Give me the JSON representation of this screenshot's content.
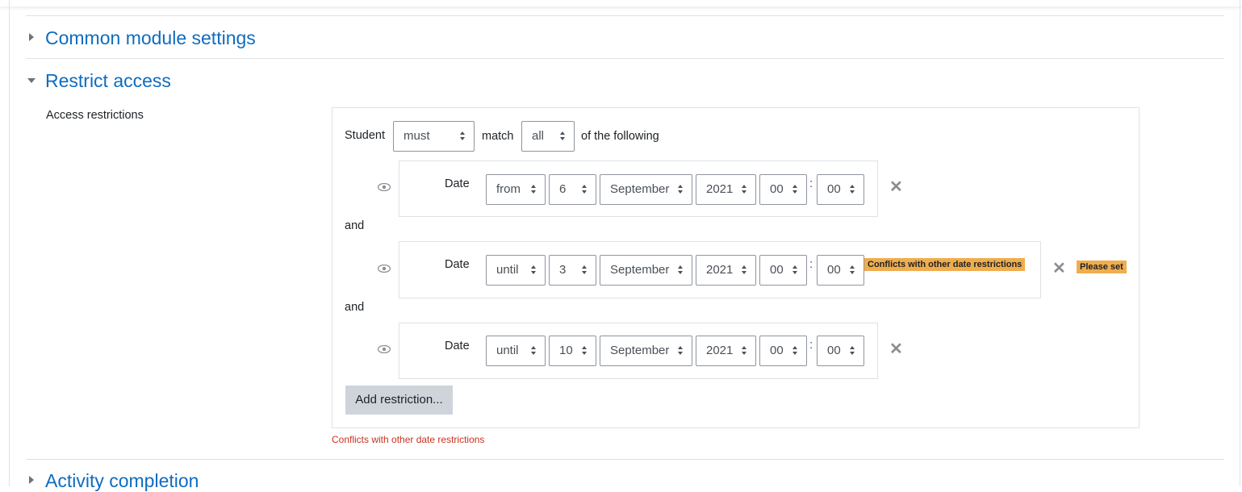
{
  "sections": {
    "common": {
      "title": "Common module settings"
    },
    "restrict": {
      "title": "Restrict access",
      "field_label": "Access restrictions"
    },
    "completion": {
      "title": "Activity completion"
    }
  },
  "header_row": {
    "student_label": "Student",
    "must_value": "must",
    "match_label": "match",
    "all_value": "all",
    "following_label": "of the following"
  },
  "conditions": [
    {
      "date_label": "Date",
      "direction": "from",
      "day": "6",
      "month": "September",
      "year": "2021",
      "hour": "00",
      "minute": "00",
      "colon": ":"
    },
    {
      "connector": "and",
      "date_label": "Date",
      "direction": "until",
      "day": "3",
      "month": "September",
      "year": "2021",
      "hour": "00",
      "minute": "00",
      "colon": ":",
      "conflict_badge": "Conflicts with other date restrictions",
      "please_set": "Please set"
    },
    {
      "connector": "and",
      "date_label": "Date",
      "direction": "until",
      "day": "10",
      "month": "September",
      "year": "2021",
      "hour": "00",
      "minute": "00",
      "colon": ":"
    }
  ],
  "add_restriction_label": "Add restriction...",
  "error_text": "Conflicts with other date restrictions",
  "icons": {
    "eye": "eye-icon",
    "delete": "close-icon",
    "expand": "caret-right-icon",
    "collapse": "caret-down-icon"
  },
  "colors": {
    "link": "#0f6cbf",
    "badge": "#f0ad4e",
    "error": "#ca3120",
    "button": "#ced4da"
  }
}
